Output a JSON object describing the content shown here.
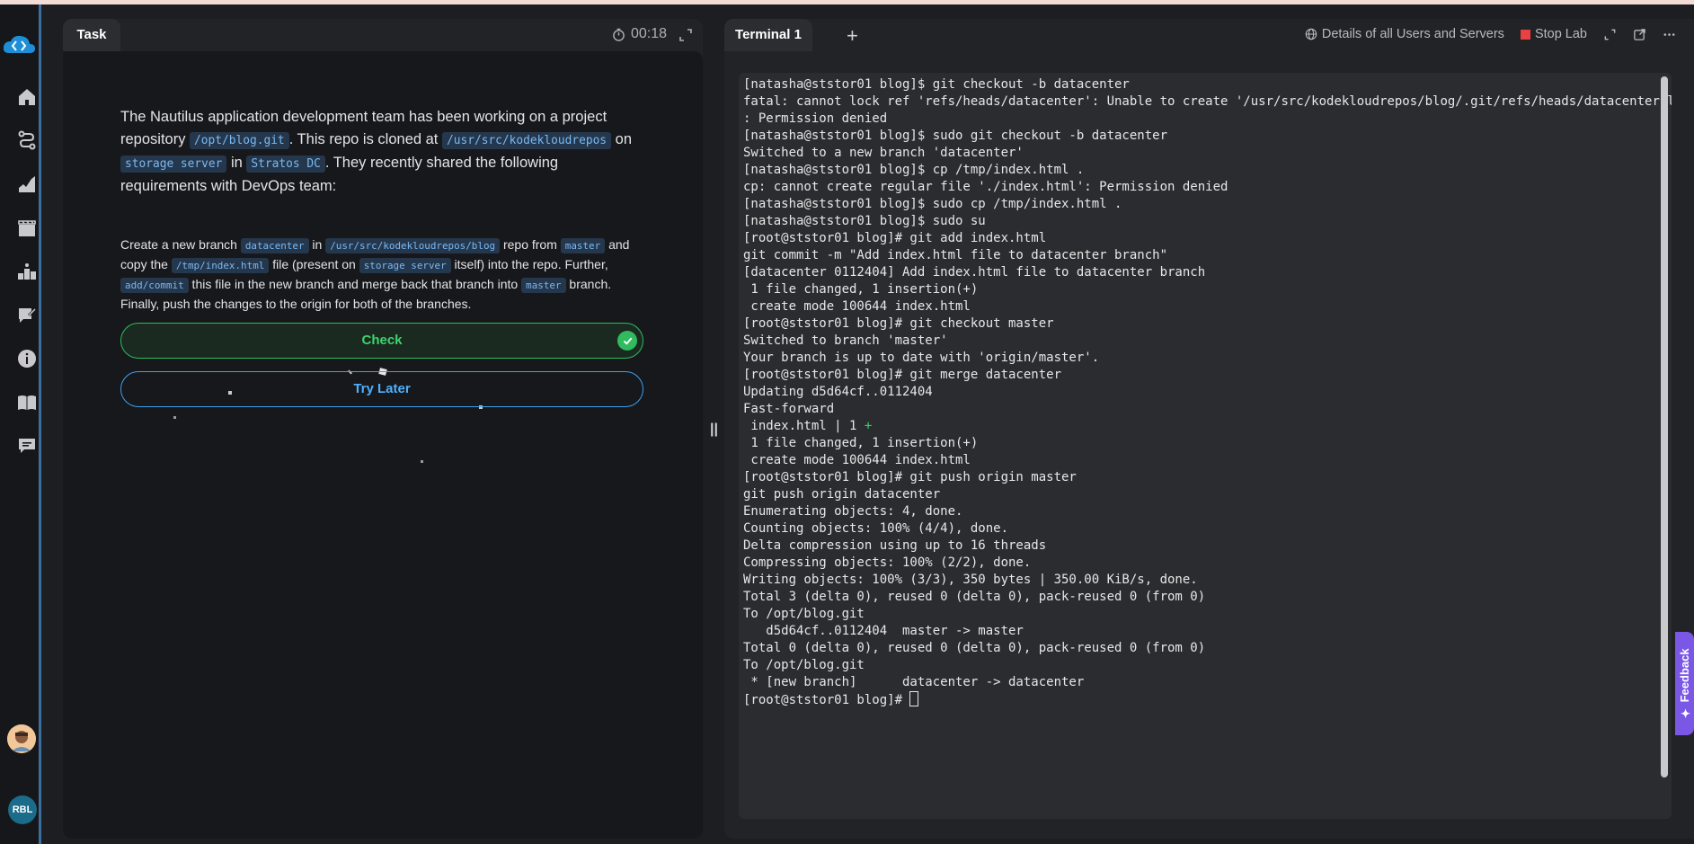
{
  "sidebar": {
    "items": [
      {
        "name": "home-icon"
      },
      {
        "name": "path-icon"
      },
      {
        "name": "skill-icon"
      },
      {
        "name": "video-icon"
      },
      {
        "name": "leaderboard-icon"
      },
      {
        "name": "blog-icon"
      },
      {
        "name": "info-icon"
      },
      {
        "name": "book-icon"
      },
      {
        "name": "chat-icon"
      }
    ],
    "user_initials": "RBL"
  },
  "task": {
    "tab_label": "Task",
    "timer": "00:18",
    "paragraph1": {
      "t1": "The Nautilus application development team has been working on a project repository ",
      "c1": "/opt/blog.git",
      "t2": ". This repo is cloned at ",
      "c2": "/usr/src/kodekloudrepos",
      "t3": " on ",
      "c3": "storage server",
      "t4": " in ",
      "c4": "Stratos DC",
      "t5": ". They recently shared the following requirements with DevOps team:"
    },
    "paragraph2": {
      "t1": "Create a new branch ",
      "c1": "datacenter",
      "t2": " in ",
      "c2": "/usr/src/kodekloudrepos/blog",
      "t3": " repo from ",
      "c3": "master",
      "t4": " and copy the ",
      "c4": "/tmp/index.html",
      "t5": " file (present on ",
      "c5": "storage server",
      "t6": " itself) into the repo. Further, ",
      "c6": "add/commit",
      "t7": " this file in the new branch and merge back that branch into ",
      "c7": "master",
      "t8": " branch. Finally, push the changes to the origin for both of the branches."
    },
    "check_label": "Check",
    "try_later_label": "Try Later"
  },
  "terminal": {
    "tab_label": "Terminal 1",
    "add_tab": "+",
    "details_label": "Details of all Users and Servers",
    "stop_label": "Stop Lab",
    "lines": [
      "[natasha@ststor01 blog]$ git checkout -b datacenter",
      "fatal: cannot lock ref 'refs/heads/datacenter': Unable to create '/usr/src/kodekloudrepos/blog/.git/refs/heads/datacenter.lock'",
      ": Permission denied",
      "[natasha@ststor01 blog]$ sudo git checkout -b datacenter",
      "Switched to a new branch 'datacenter'",
      "[natasha@ststor01 blog]$ cp /tmp/index.html .",
      "cp: cannot create regular file './index.html': Permission denied",
      "[natasha@ststor01 blog]$ sudo cp /tmp/index.html .",
      "[natasha@ststor01 blog]$ sudo su",
      "[root@ststor01 blog]# git add index.html",
      "git commit -m \"Add index.html file to datacenter branch\"",
      "[datacenter 0112404] Add index.html file to datacenter branch",
      " 1 file changed, 1 insertion(+)",
      " create mode 100644 index.html",
      "[root@ststor01 blog]# git checkout master",
      "Switched to branch 'master'",
      "Your branch is up to date with 'origin/master'.",
      "[root@ststor01 blog]# git merge datacenter",
      "Updating d5d64cf..0112404",
      "Fast-forward",
      " index.html | 1 ",
      " 1 file changed, 1 insertion(+)",
      " create mode 100644 index.html",
      "[root@ststor01 blog]# git push origin master",
      "git push origin datacenter",
      "Enumerating objects: 4, done.",
      "Counting objects: 100% (4/4), done.",
      "Delta compression using up to 16 threads",
      "Compressing objects: 100% (2/2), done.",
      "Writing objects: 100% (3/3), 350 bytes | 350.00 KiB/s, done.",
      "Total 3 (delta 0), reused 0 (delta 0), pack-reused 0 (from 0)",
      "To /opt/blog.git",
      "   d5d64cf..0112404  master -> master",
      "Total 0 (delta 0), reused 0 (delta 0), pack-reused 0 (from 0)",
      "To /opt/blog.git",
      " * [new branch]      datacenter -> datacenter",
      "[root@ststor01 blog]# "
    ],
    "diffstat_plus": "+"
  },
  "feedback_label": "✦ Feedback",
  "colors": {
    "accent_green": "#2fbb5e",
    "accent_blue": "#3ea0ee",
    "stop_red": "#e84141",
    "feedback_purple": "#7b57e6"
  }
}
